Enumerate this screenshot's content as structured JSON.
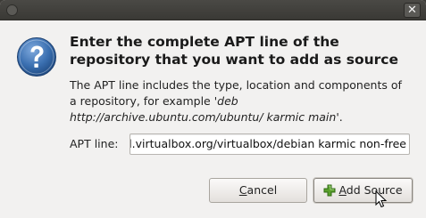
{
  "window": {
    "close_glyph": "✕"
  },
  "dialog": {
    "heading": "Enter the complete APT line of the repository that you want to add as source",
    "description_prefix": "The APT line includes the type, location and components of a repository, for example  '",
    "description_example": "deb http://archive.ubuntu.com/ubuntu/ karmic main",
    "description_suffix": "'.",
    "apt_label": "APT line:",
    "apt_value": "deb http://download.virtualbox.org/virtualbox/debian karmic non-free",
    "cancel": {
      "mnemonic": "C",
      "rest": "ancel"
    },
    "add_source": {
      "mnemonic": "A",
      "rest": "dd Source"
    }
  },
  "icons": {
    "dialog_icon": "question-icon",
    "add_icon": "plus-icon",
    "window_menu_icon": "window-menu-icon",
    "cursor": "mouse-pointer-icon"
  },
  "colors": {
    "question_blue": "#3a6fb0",
    "plus_green": "#5aa02c"
  }
}
